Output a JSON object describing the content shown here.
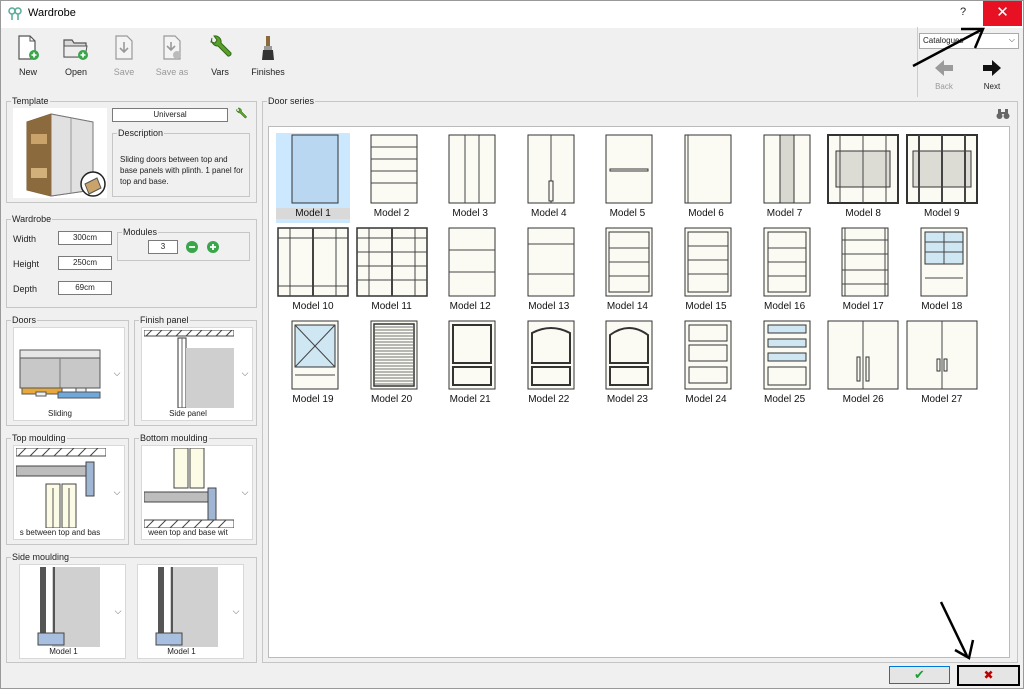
{
  "window": {
    "title": "Wardrobe",
    "help_label": "?",
    "close_label": "✕"
  },
  "toolbar": {
    "new_label": "New",
    "open_label": "Open",
    "save_label": "Save",
    "save_as_label": "Save as",
    "vars_label": "Vars",
    "finishes_label": "Finishes"
  },
  "catalog": {
    "selected": "Catalogues"
  },
  "nav": {
    "back_label": "Back",
    "next_label": "Next"
  },
  "template": {
    "group_title": "Template",
    "name_value": "Universal",
    "description_title": "Description",
    "description_text": "Sliding doors between top and base panels with plinth. 1 panel for top and base."
  },
  "wardrobe": {
    "group_title": "Wardrobe",
    "width_label": "Width",
    "width_value": "300cm",
    "height_label": "Height",
    "height_value": "250cm",
    "depth_label": "Depth",
    "depth_value": "69cm",
    "modules_title": "Modules",
    "modules_value": "3"
  },
  "doors": {
    "group_title": "Doors",
    "value": "Sliding"
  },
  "finish_panel": {
    "group_title": "Finish panel",
    "value": "Side panel"
  },
  "top_moulding": {
    "group_title": "Top moulding",
    "value": "s between top and bas"
  },
  "bottom_moulding": {
    "group_title": "Bottom moulding",
    "value": "ween top and base wit"
  },
  "side_moulding": {
    "group_title": "Side moulding",
    "left_value": "Model 1",
    "right_value": "Model 1"
  },
  "door_series": {
    "group_title": "Door series",
    "models": [
      "Model 1",
      "Model 2",
      "Model 3",
      "Model 4",
      "Model 5",
      "Model 6",
      "Model 7",
      "Model 8",
      "Model 9",
      "Model 10",
      "Model 11",
      "Model 12",
      "Model 13",
      "Model 14",
      "Model 15",
      "Model 16",
      "Model 17",
      "Model 18",
      "Model 19",
      "Model 20",
      "Model 21",
      "Model 22",
      "Model 23",
      "Model 24",
      "Model 25",
      "Model 26",
      "Model 27"
    ]
  },
  "dialog_buttons": {
    "ok_label": "✔",
    "cancel_label": "✖"
  },
  "colors": {
    "close_red": "#e81123",
    "selected_blue": "#cce8ff",
    "ok_green": "#1e9e3a",
    "cancel_red": "#c00000",
    "door_fill": "#fbfbf3"
  }
}
